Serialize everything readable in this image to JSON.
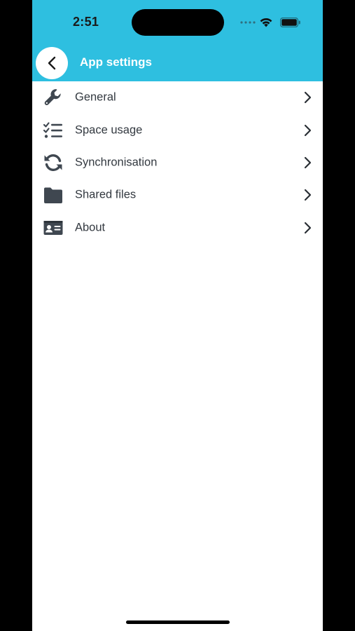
{
  "status_bar": {
    "time": "2:51",
    "icons": [
      "signal-dots-icon",
      "wifi-icon",
      "battery-icon"
    ]
  },
  "header": {
    "title": "App settings",
    "back_icon": "chevron-left-icon",
    "background_color": "#2ebfe0"
  },
  "menu": {
    "items": [
      {
        "label": "General",
        "icon": "wrench-icon"
      },
      {
        "label": "Space usage",
        "icon": "checklist-icon"
      },
      {
        "label": "Synchronisation",
        "icon": "sync-icon"
      },
      {
        "label": "Shared files",
        "icon": "folder-icon"
      },
      {
        "label": "About",
        "icon": "id-card-icon"
      }
    ],
    "chevron_icon": "chevron-right-icon",
    "icon_color": "#3f4750"
  }
}
